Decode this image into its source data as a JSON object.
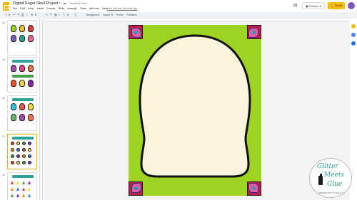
{
  "title_bar": {
    "doc_title": "Digital Sugar Skull Project",
    "saved_status": "Saved to Drive",
    "last_edit": "Last edit was seconds ago",
    "star_icon": "star-icon",
    "move_icon": "folder-icon",
    "cloud_icon": "cloud-icon"
  },
  "menu": {
    "items": [
      "File",
      "Edit",
      "View",
      "Insert",
      "Format",
      "Slide",
      "Arrange",
      "Tools",
      "Add-ons",
      "Help"
    ]
  },
  "actions": {
    "present_label": "Present",
    "share_label": "Share",
    "share_color": "#fbbc04"
  },
  "toolbar": {
    "background_label": "Background",
    "layout_label": "Layout",
    "theme_label": "Theme",
    "transition_label": "Transition"
  },
  "filmstrip": {
    "slide_numbers": [
      "18",
      "19",
      "20",
      "21",
      "22"
    ]
  },
  "slide": {
    "background_color": "#9fd323",
    "skull_fill": "#fcf4dc",
    "corner_colors": [
      "#bf1e4b",
      "#e65c9c",
      "#16a0c0"
    ]
  },
  "brand": {
    "line1": "Glitter",
    "line2": "Meets",
    "line3": "Glue",
    "tagline": "BRINGING ART TO THE CLASSROOM"
  }
}
